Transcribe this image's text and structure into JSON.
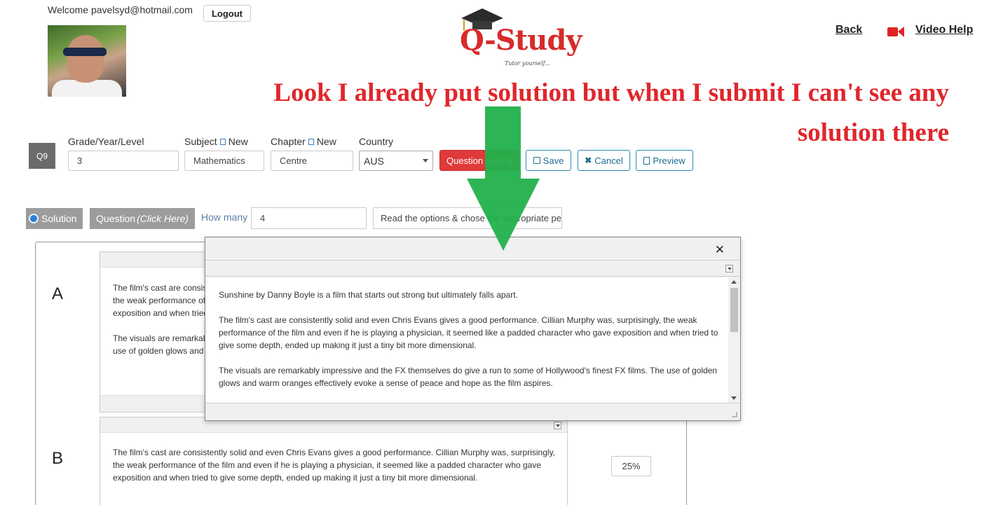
{
  "header": {
    "welcome": "Welcome pavelsyd@hotmail.com",
    "logout_label": "Logout",
    "logo_text": "Q-Study",
    "logo_tagline": "Tutor yourself...",
    "back_label": "Back",
    "video_help_label": "Video Help"
  },
  "annotation": {
    "text": "Look I already put solution but when I submit I can't see any solution there",
    "color": "#e0262b",
    "arrow_color": "#22b14c"
  },
  "form": {
    "question_badge": "Q9",
    "grade_label": "Grade/Year/Level",
    "grade_value": "3",
    "subject_label": "Subject",
    "subject_new": "New",
    "subject_value": "Mathematics",
    "chapter_label": "Chapter",
    "chapter_new": "New",
    "chapter_value": "Centre",
    "country_label": "Country",
    "country_value": "AUS",
    "question_setting_label": "Question setting",
    "save_label": "Save",
    "cancel_label": "Cancel",
    "preview_label": "Preview"
  },
  "toolbar2": {
    "solution_label": "Solution",
    "question_label": "Question",
    "question_hint": "(Click Here)",
    "how_many_label": "How many",
    "how_many_value": "4",
    "instruction_value": "Read the options & chose the appropriate pe"
  },
  "options": [
    {
      "letter": "A",
      "lines": [
        "The film's cast are consist",
        "the weak performance of",
        "exposition and when tried",
        "The visuals are remarkab",
        "use of golden glows and w"
      ]
    },
    {
      "letter": "B",
      "lines": [
        "The film's cast are consistently solid and even Chris Evans gives a good performance. Cillian Murphy was, surprisingly,",
        "the weak performance of the film and even if he is playing a physician, it seemed like a padded character who gave",
        "exposition and when tried to give some depth, ended up making it just a tiny bit more dimensional."
      ],
      "percent": "25%"
    }
  ],
  "modal": {
    "paragraphs": [
      "Sunshine by Danny Boyle is a film that starts out strong but ultimately falls apart.",
      "The film's cast are consistently solid and even Chris Evans gives a good performance. Cillian Murphy was, surprisingly, the weak performance of the film and even if he is playing a physician, it seemed like a padded character who gave exposition and when tried to give some depth, ended up making it just a tiny bit more dimensional.",
      "The visuals are remarkably impressive and the FX themselves do give a run to some of Hollywood's finest FX films. The use of golden glows and warm oranges effectively evoke a sense of peace and hope as the film aspires."
    ]
  }
}
